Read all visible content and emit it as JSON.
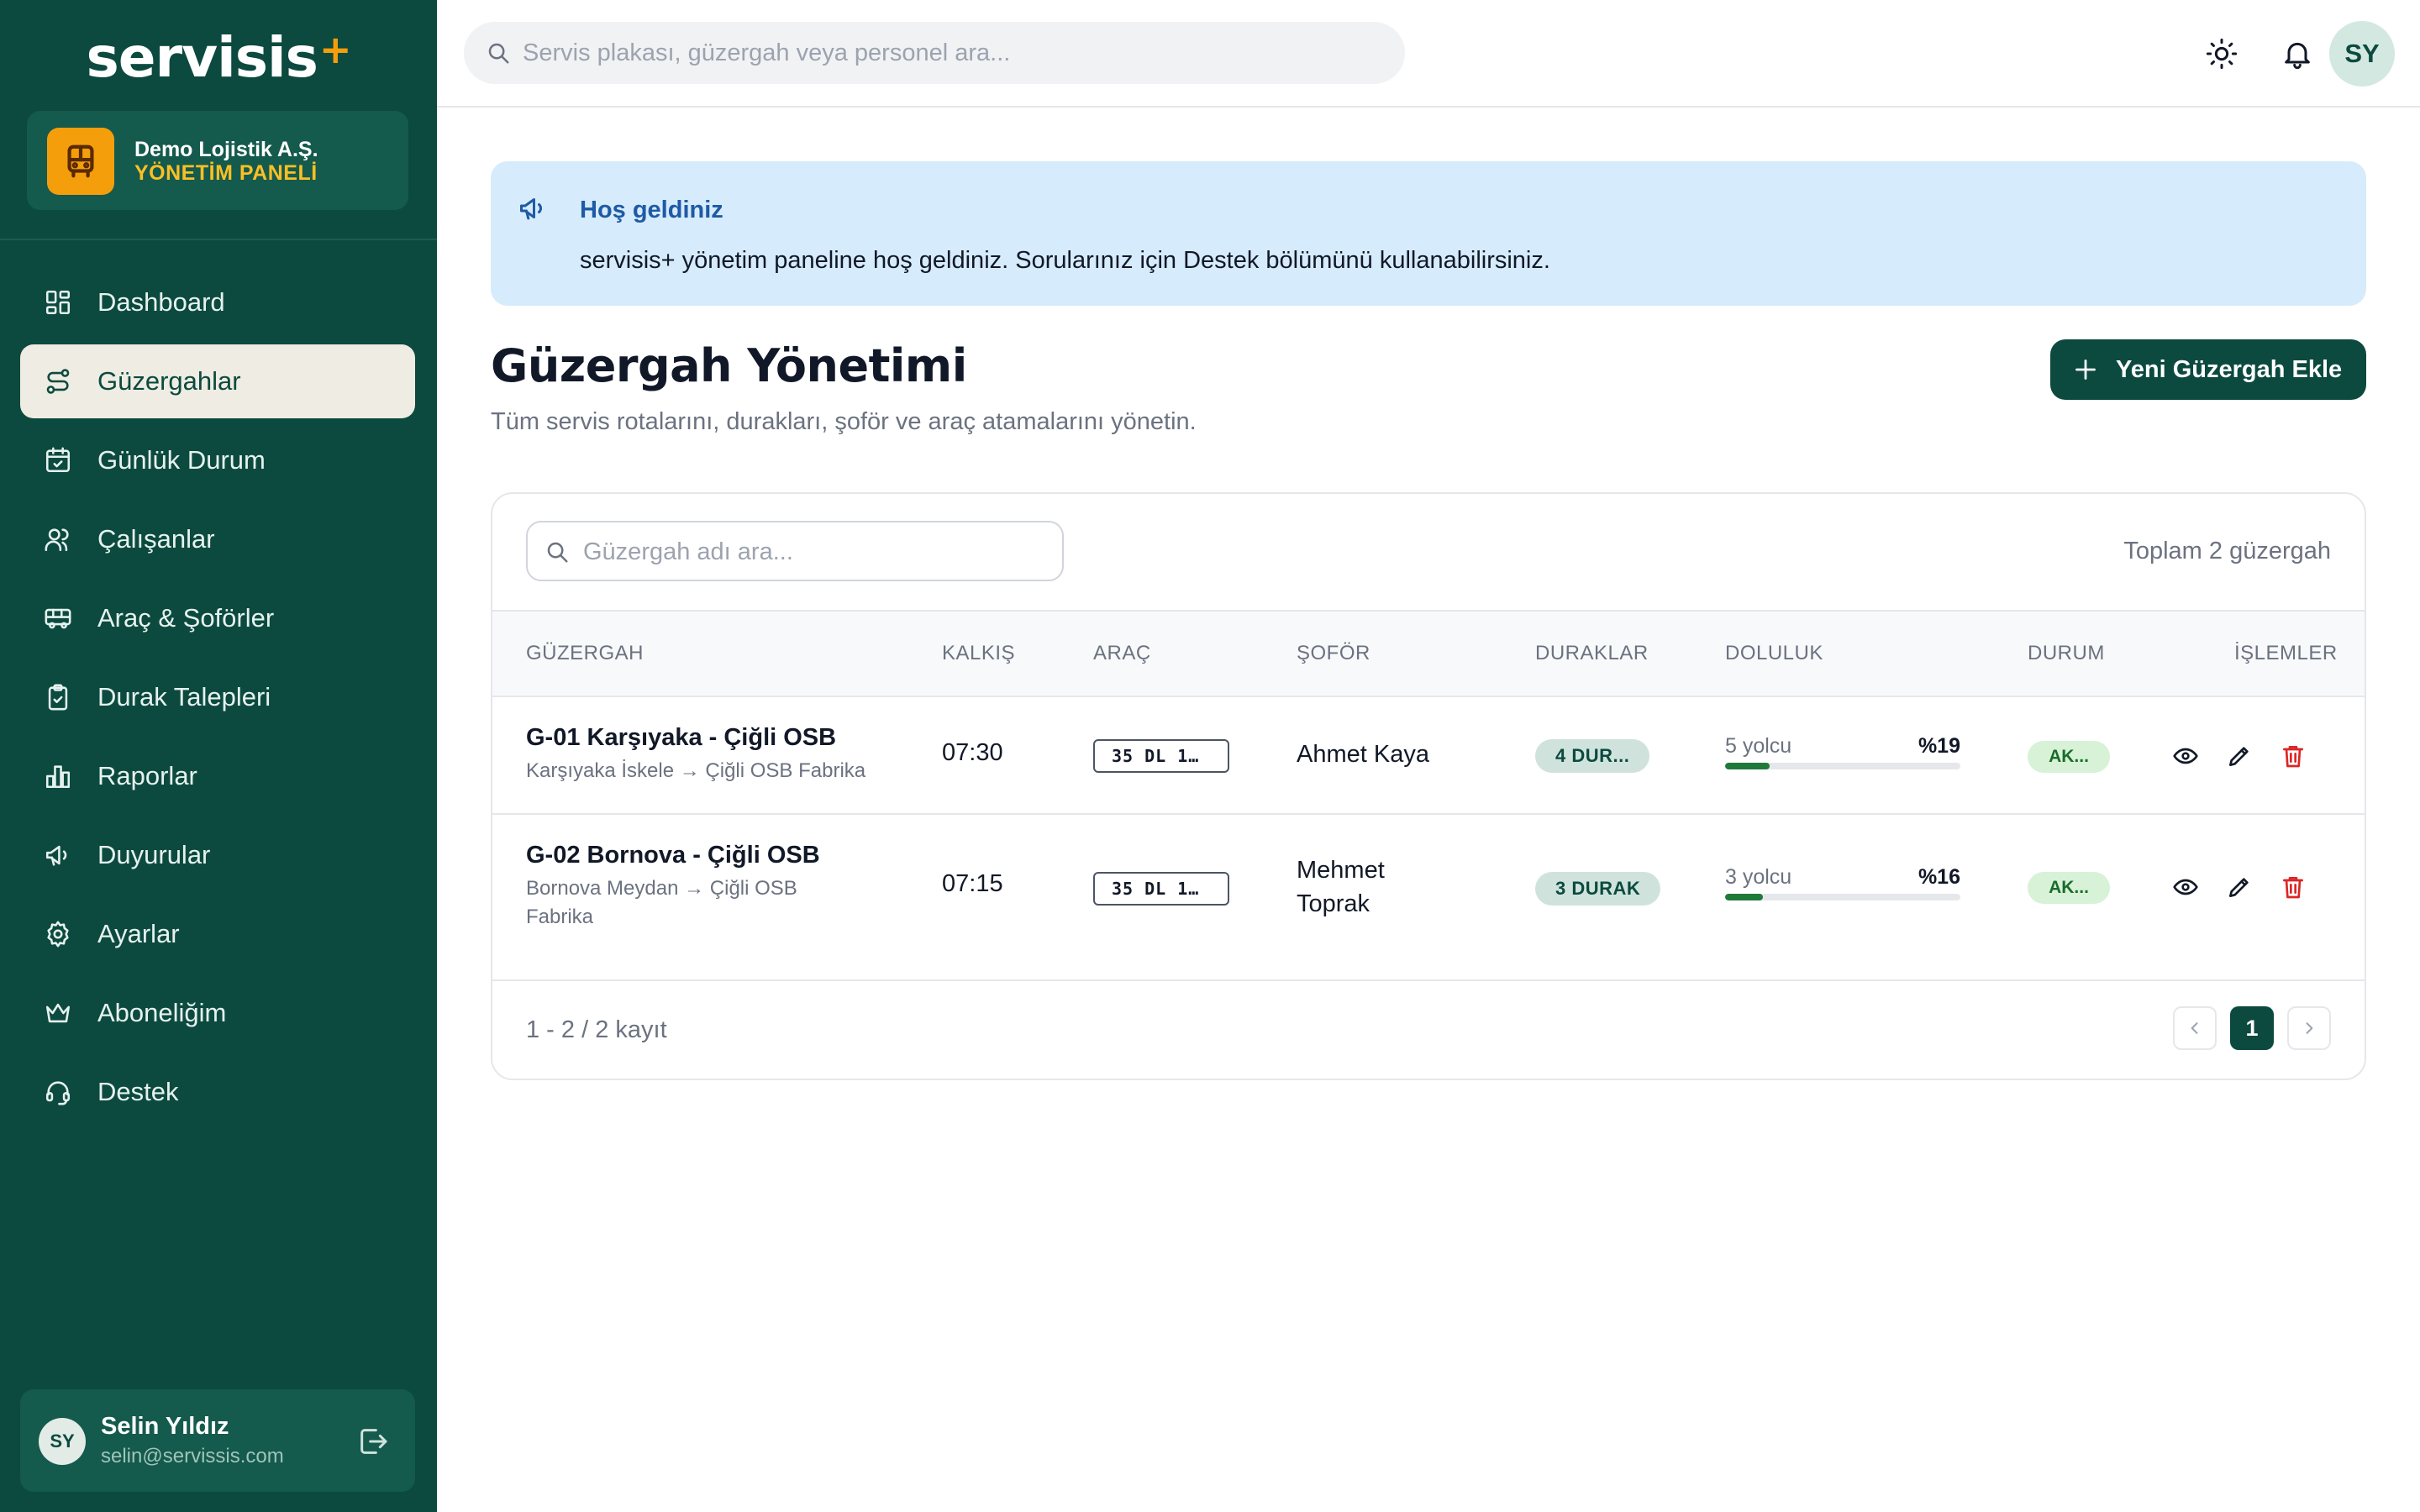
{
  "sidebar": {
    "logo_text": "servisis",
    "logo_mark": "+",
    "company": {
      "name": "Demo Lojistik A.Ş.",
      "role": "YÖNETİM PANELİ",
      "icon": "bus-icon"
    },
    "items": [
      {
        "label": "Dashboard",
        "icon": "grid-icon",
        "active": false
      },
      {
        "label": "Güzergahlar",
        "icon": "route-icon",
        "active": true
      },
      {
        "label": "Günlük Durum",
        "icon": "calendar-check-icon",
        "active": false
      },
      {
        "label": "Çalışanlar",
        "icon": "users-icon",
        "active": false
      },
      {
        "label": "Araç & Şoförler",
        "icon": "bus-icon",
        "active": false
      },
      {
        "label": "Durak Talepleri",
        "icon": "clipboard-icon",
        "active": false
      },
      {
        "label": "Raporlar",
        "icon": "bar-chart-icon",
        "active": false
      },
      {
        "label": "Duyurular",
        "icon": "megaphone-icon",
        "active": false
      },
      {
        "label": "Ayarlar",
        "icon": "gear-icon",
        "active": false
      },
      {
        "label": "Aboneliğim",
        "icon": "crown-icon",
        "active": false
      },
      {
        "label": "Destek",
        "icon": "headset-icon",
        "active": false
      }
    ],
    "user": {
      "initials": "SY",
      "name": "Selin Yıldız",
      "email": "selin@servissis.com"
    }
  },
  "topbar": {
    "search_placeholder": "Servis plakası, güzergah veya personel ara...",
    "avatar_initials": "SY"
  },
  "banner": {
    "title": "Hoş geldiniz",
    "text": "servisis+ yönetim paneline hoş geldiniz. Sorularınız için Destek bölümünü kullanabilirsiniz."
  },
  "page": {
    "title": "Güzergah Yönetimi",
    "subtitle": "Tüm servis rotalarını, durakları, şoför ve araç atamalarını yönetin.",
    "add_button": "Yeni Güzergah Ekle"
  },
  "table": {
    "search_placeholder": "Güzergah adı ara...",
    "total_text": "Toplam 2 güzergah",
    "headers": {
      "route": "GÜZERGAH",
      "departure": "KALKIŞ",
      "vehicle": "ARAÇ",
      "driver": "ŞOFÖR",
      "stops": "DURAKLAR",
      "occupancy": "DOLULUK",
      "status": "DURUM",
      "actions": "İŞLEMLER"
    },
    "rows": [
      {
        "name": "G-01 Karşıyaka - Çiğli OSB",
        "path": "Karşıyaka İskele → Çiğli OSB Fabrika",
        "departure": "07:30",
        "plate": "35 DL 1…",
        "driver": "Ahmet Kaya",
        "stops": "4 DUR...",
        "passengers": "5 yolcu",
        "occupancy_label": "%19",
        "occupancy_pct": 19,
        "status": "AK..."
      },
      {
        "name": "G-02 Bornova - Çiğli OSB",
        "path": "Bornova Meydan → Çiğli OSB Fabrika",
        "departure": "07:15",
        "plate": "35 DL 1…",
        "driver": "Mehmet Toprak",
        "stops": "3 DURAK",
        "passengers": "3 yolcu",
        "occupancy_label": "%16",
        "occupancy_pct": 16,
        "status": "AK..."
      }
    ],
    "range_text": "1 - 2 / 2 kayıt",
    "current_page": "1"
  },
  "colors": {
    "sidebar_bg": "#0c4a3f",
    "accent": "#f59e0b",
    "banner_bg": "#d6ebfb",
    "occupancy_fill": "#1f7a3a",
    "delete_red": "#dc2626"
  }
}
